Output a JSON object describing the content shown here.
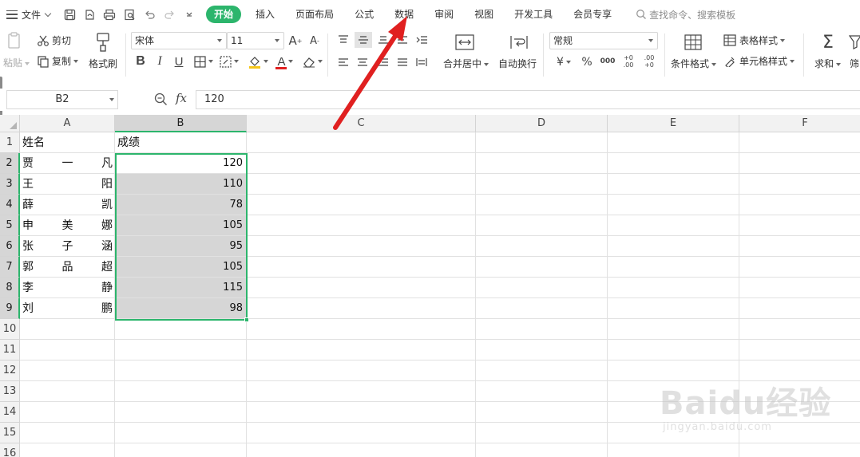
{
  "menubar": {
    "file_label": "文件",
    "tabs": [
      {
        "label": "开始",
        "active": true
      },
      {
        "label": "插入"
      },
      {
        "label": "页面布局"
      },
      {
        "label": "公式"
      },
      {
        "label": "数据"
      },
      {
        "label": "审阅"
      },
      {
        "label": "视图"
      },
      {
        "label": "开发工具"
      },
      {
        "label": "会员专享"
      }
    ],
    "search_placeholder": "查找命令、搜索模板",
    "accent_color": "#2cb56c"
  },
  "ribbon": {
    "clipboard": {
      "paste": "粘贴",
      "cut": "剪切",
      "copy": "复制",
      "format_painter": "格式刷"
    },
    "font": {
      "name": "宋体",
      "size": "11",
      "bold": "B",
      "italic": "I",
      "underline": "U",
      "font_color_letter": "A"
    },
    "alignment": {
      "merge_center": "合并居中",
      "wrap_text": "自动换行"
    },
    "number": {
      "format": "常规",
      "currency": "¥",
      "percent": "%",
      "thousands": "000",
      "dec_inc": "+0 .00",
      "dec_dec": ".00 +0"
    },
    "styles": {
      "conditional_format": "条件格式",
      "table_style": "表格样式",
      "cell_style": "单元格样式"
    },
    "editing": {
      "sum": "求和",
      "filter": "筛"
    }
  },
  "formula_bar": {
    "name_box": "B2",
    "fx_symbol": "fx",
    "value": "120"
  },
  "sheet": {
    "columns": [
      "A",
      "B",
      "C",
      "D",
      "E",
      "F"
    ],
    "row_numbers": [
      "1",
      "2",
      "3",
      "4",
      "5",
      "6",
      "7",
      "8",
      "9",
      "10",
      "11",
      "12",
      "13",
      "14",
      "15",
      "16"
    ],
    "header_row": {
      "a": "姓名",
      "b": "成绩"
    },
    "rows": [
      {
        "name": [
          "贾",
          "一",
          "凡"
        ],
        "score": "120"
      },
      {
        "name": [
          "王",
          "阳"
        ],
        "score": "110"
      },
      {
        "name": [
          "薛",
          "凯"
        ],
        "score": "78"
      },
      {
        "name": [
          "申",
          "美",
          "娜"
        ],
        "score": "105"
      },
      {
        "name": [
          "张",
          "子",
          "涵"
        ],
        "score": "95"
      },
      {
        "name": [
          "郭",
          "品",
          "超"
        ],
        "score": "105"
      },
      {
        "name": [
          "李",
          "静"
        ],
        "score": "115"
      },
      {
        "name": [
          "刘",
          "鹏"
        ],
        "score": "98"
      }
    ],
    "selected_range": "B2:B9",
    "selection_color": "#2cb56c"
  },
  "annotation": {
    "arrow_color": "#e02020",
    "arrow_target": "数据"
  },
  "watermark": {
    "brand": "Baidu经验",
    "url": "jingyan.baidu.com"
  }
}
